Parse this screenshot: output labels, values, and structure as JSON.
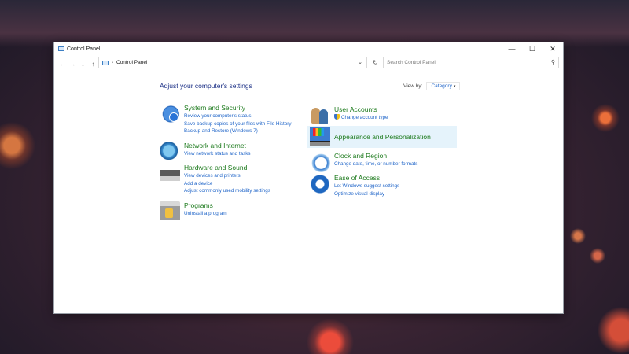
{
  "window": {
    "title": "Control Panel",
    "controls": {
      "minimize": "—",
      "maximize": "☐",
      "close": "✕"
    }
  },
  "nav": {
    "back": "←",
    "forward": "→",
    "down": "⌄",
    "up": "↑",
    "refresh": "↻"
  },
  "address": {
    "separator": "›",
    "path": "Control Panel",
    "dropdown": "⌄"
  },
  "search": {
    "placeholder": "Search Control Panel",
    "icon": "search-icon"
  },
  "main": {
    "heading": "Adjust your computer's settings",
    "view_by_label": "View by:",
    "view_by_value": "Category",
    "view_by_caret": "▾"
  },
  "categories": [
    {
      "title": "System and Security",
      "icon": "shield-icon",
      "links": [
        "Review your computer's status",
        "Save backup copies of your files with File History",
        "Backup and Restore (Windows 7)"
      ]
    },
    {
      "title": "Network and Internet",
      "icon": "globe-network-icon",
      "links": [
        "View network status and tasks"
      ]
    },
    {
      "title": "Hardware and Sound",
      "icon": "printer-icon",
      "links": [
        "View devices and printers",
        "Add a device",
        "Adjust commonly used mobility settings"
      ]
    },
    {
      "title": "Programs",
      "icon": "programs-icon",
      "links": [
        "Uninstall a program"
      ]
    },
    {
      "title": "User Accounts",
      "icon": "users-icon",
      "links": [
        "Change account type"
      ]
    },
    {
      "title": "Appearance and Personalization",
      "icon": "monitor-palette-icon",
      "links": []
    },
    {
      "title": "Clock and Region",
      "icon": "clock-globe-icon",
      "links": [
        "Change date, time, or number formats"
      ]
    },
    {
      "title": "Ease of Access",
      "icon": "ease-of-access-icon",
      "links": [
        "Let Windows suggest settings",
        "Optimize visual display"
      ]
    }
  ],
  "colors": {
    "category_title": "#1c7a1c",
    "link": "#1e64c8",
    "heading": "#1e3287",
    "hover_bg": "#e5f3fb"
  }
}
